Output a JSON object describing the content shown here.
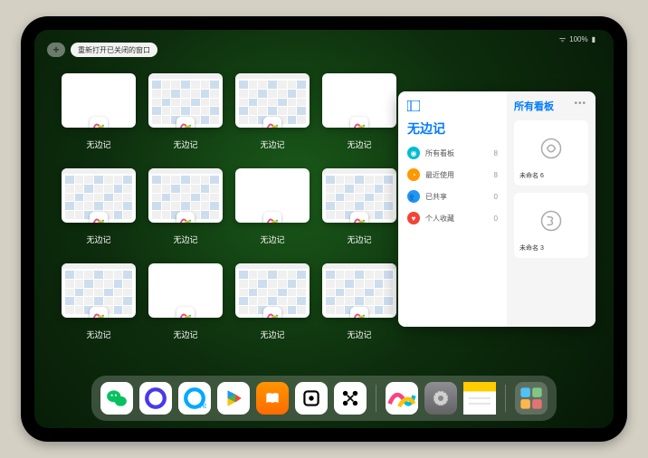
{
  "status": {
    "time": "",
    "wifi": "",
    "battery": "100%"
  },
  "topbar": {
    "plus": "+",
    "reopen_label": "重新打开已关闭的窗口"
  },
  "windows": [
    {
      "label": "无边记",
      "type": "blank"
    },
    {
      "label": "无边记",
      "type": "calendar"
    },
    {
      "label": "无边记",
      "type": "calendar"
    },
    {
      "label": "无边记",
      "type": "blank"
    },
    {
      "label": "无边记",
      "type": "calendar"
    },
    {
      "label": "无边记",
      "type": "calendar"
    },
    {
      "label": "无边记",
      "type": "blank"
    },
    {
      "label": "无边记",
      "type": "calendar"
    },
    {
      "label": "无边记",
      "type": "calendar"
    },
    {
      "label": "无边记",
      "type": "blank"
    },
    {
      "label": "无边记",
      "type": "calendar"
    },
    {
      "label": "无边记",
      "type": "calendar"
    }
  ],
  "large_window": {
    "app_title": "无边记",
    "right_title": "所有看板",
    "menu": [
      {
        "label": "所有看板",
        "count": "8",
        "color": "#00bcd4"
      },
      {
        "label": "最近使用",
        "count": "8",
        "color": "#ff9800"
      },
      {
        "label": "已共享",
        "count": "0",
        "color": "#2196f3"
      },
      {
        "label": "个人收藏",
        "count": "0",
        "color": "#f44336"
      }
    ],
    "cards": [
      {
        "label": "未命名 6",
        "sub": ""
      },
      {
        "label": "未命名 3",
        "sub": ""
      }
    ]
  },
  "dock": {
    "icons": [
      {
        "name": "wechat",
        "bg": "#fff"
      },
      {
        "name": "quark-browser",
        "bg": "#fff"
      },
      {
        "name": "qq-browser",
        "bg": "#fff"
      },
      {
        "name": "play-video",
        "bg": "#fff"
      },
      {
        "name": "books",
        "bg": "linear-gradient(#ff9500,#ff6b00)"
      },
      {
        "name": "dice",
        "bg": "#fff"
      },
      {
        "name": "connect",
        "bg": "#fff"
      },
      {
        "name": "freeform",
        "bg": "#fff"
      },
      {
        "name": "settings",
        "bg": "linear-gradient(#8e8e93,#636366)"
      },
      {
        "name": "notes",
        "bg": "linear-gradient(#fff,#ffeb3b 30%,#fff 30%)"
      },
      {
        "name": "app-library",
        "bg": "rgba(255,255,255,0.2)"
      }
    ]
  }
}
